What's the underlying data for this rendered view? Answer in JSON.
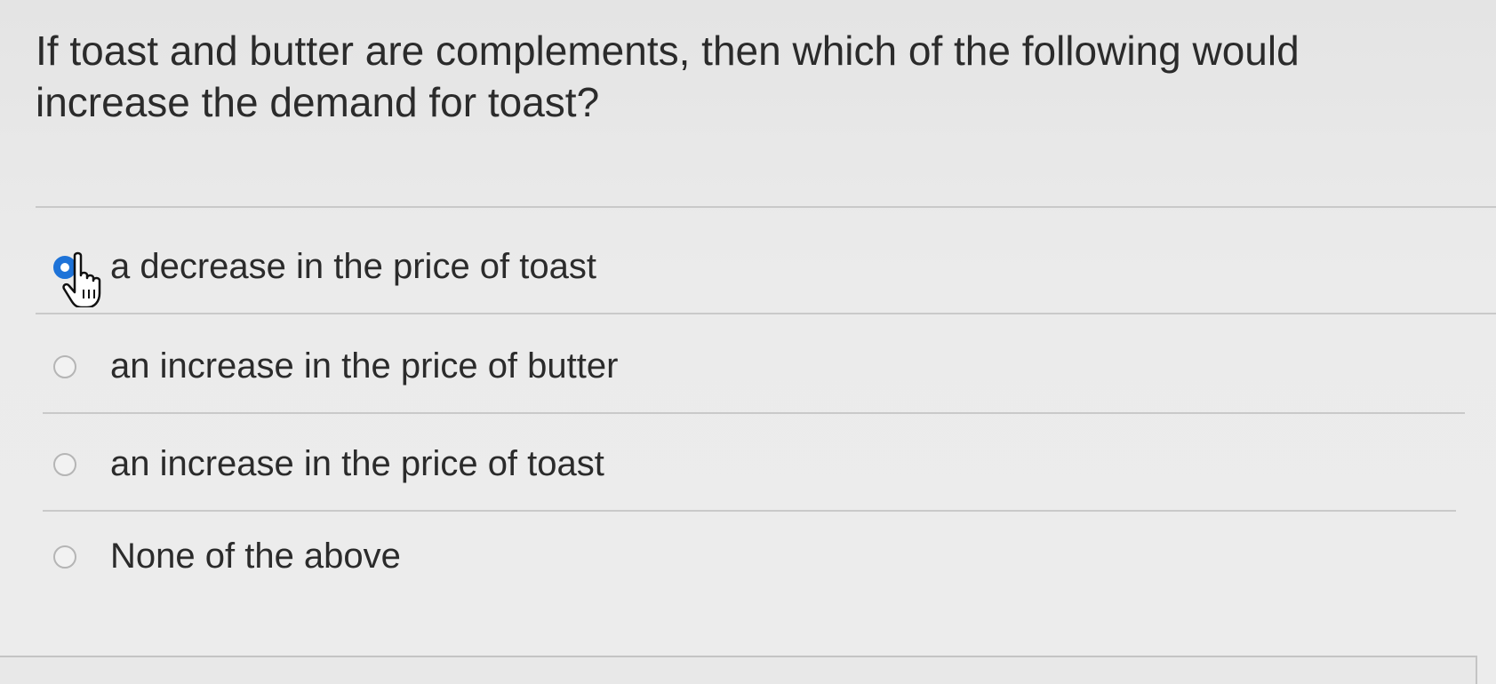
{
  "question": {
    "text": "If toast and butter are complements, then which of the following would increase the demand for toast?"
  },
  "options": [
    {
      "label": "a decrease in the price of toast",
      "selected": true
    },
    {
      "label": "an increase in the price of butter",
      "selected": false
    },
    {
      "label": "an increase in the price of toast",
      "selected": false
    },
    {
      "label": "None of the above",
      "selected": false
    }
  ],
  "colors": {
    "accent": "#1e73d8",
    "background": "#e9e9e9",
    "text": "#2b2b2b"
  },
  "cursor_icon": "hand-pointer-icon"
}
